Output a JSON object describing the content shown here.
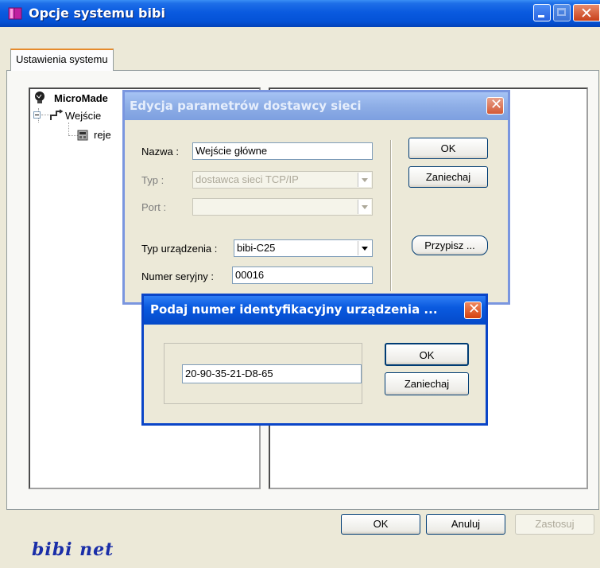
{
  "window": {
    "title": "Opcje systemu bibi"
  },
  "tabs": [
    {
      "label": "Ustawienia systemu"
    }
  ],
  "tree": {
    "root": "MicroMade",
    "child": "Wejście",
    "grandchild": "reje"
  },
  "footer": {
    "ok_label": "OK",
    "cancel_label": "Anuluj",
    "apply_label": "Zastosuj",
    "logo_text": "bibi net"
  },
  "dialog_provider": {
    "title": "Edycja parametrów dostawcy sieci",
    "name_label": "Nazwa :",
    "name_value": "Wejście główne",
    "type_label": "Typ :",
    "type_value": "dostawca sieci TCP/IP",
    "port_label": "Port :",
    "port_value": "",
    "device_type_label": "Typ urządzenia :",
    "device_type_value": "bibi-C25",
    "serial_label": "Numer seryjny :",
    "serial_value": "00016",
    "ok_label": "OK",
    "cancel_label": "Zaniechaj",
    "assign_label": "Przypisz ..."
  },
  "dialog_id": {
    "title": "Podaj numer identyfikacyjny urządzenia ...",
    "id_value": "20-90-35-21-D8-65",
    "ok_label": "OK",
    "cancel_label": "Zaniechaj"
  },
  "colors": {
    "titlebar_active": "#0a5adf",
    "titlebar_inactive": "#8eaee6",
    "logo": "#1a2ea8"
  }
}
